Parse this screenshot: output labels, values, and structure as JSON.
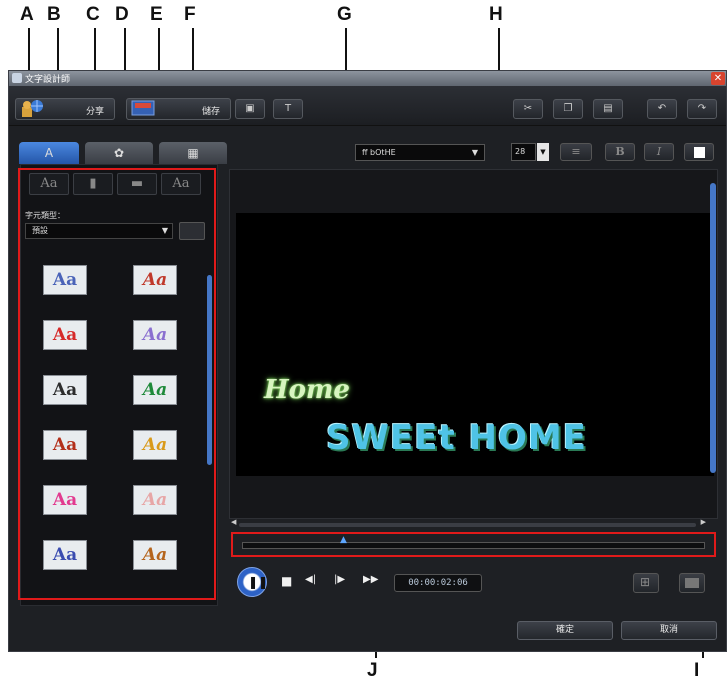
{
  "window": {
    "title": "文字設計師",
    "close_glyph": "✕"
  },
  "callouts": {
    "a": "A",
    "b": "B",
    "c": "C",
    "d": "D",
    "e": "E",
    "f": "F",
    "g": "G",
    "h": "H",
    "i": "I",
    "j": "J"
  },
  "toolbar": {
    "share_label": "分享",
    "save_label": "儲存",
    "icons": [
      "share-templates-icon",
      "save-template-icon",
      "import-image-icon",
      "insert-text-icon",
      "cut-icon",
      "copy-icon",
      "paste-icon",
      "undo-icon",
      "redo-icon"
    ]
  },
  "tabs": [
    {
      "label": "A",
      "icon": "text-properties-icon",
      "active": true
    },
    {
      "label": "✿",
      "icon": "particle-effects-icon",
      "active": false
    },
    {
      "label": "▦",
      "icon": "background-icon",
      "active": false
    }
  ],
  "left_panel": {
    "format_buttons": [
      "Aa",
      "▮",
      "▬",
      "Aa"
    ],
    "font_type_label": "字元類型：",
    "font_type_value": "預設",
    "presets": [
      {
        "text": "Aa",
        "color": "#4a63b8"
      },
      {
        "text": "Aa",
        "color": "#c0392b"
      },
      {
        "text": "Aa",
        "color": "#d62a2a"
      },
      {
        "text": "Aa",
        "color": "#8a6fd0"
      },
      {
        "text": "Aa",
        "color": "#2d2d2d"
      },
      {
        "text": "Aa",
        "color": "#1f8a3a"
      },
      {
        "text": "Aa",
        "color": "#b32f1a"
      },
      {
        "text": "Aa",
        "color": "#d99a1a"
      },
      {
        "text": "Aa",
        "color": "#e23a8f"
      },
      {
        "text": "Aa",
        "color": "#e7a6a6"
      },
      {
        "text": "Aa",
        "color": "#3a4cb0"
      },
      {
        "text": "Aa",
        "color": "#b5651d"
      }
    ]
  },
  "format_bar": {
    "font_name": "ff bOtHE",
    "font_size": "28",
    "align_glyph": "≡",
    "bold_glyph": "B",
    "italic_glyph": "I",
    "color_swatch": "#ffffff"
  },
  "preview": {
    "line1": "Home",
    "line2": "SWEEt HOME"
  },
  "timeline": {
    "marker_glyph": "▲",
    "position": 0.22
  },
  "playback": {
    "pause_glyph": "❚❚",
    "stop_glyph": "■",
    "prev_frame_glyph": "◀|",
    "next_frame_glyph": "|▶",
    "fast_forward_glyph": "▶▶",
    "timecode": "00:00:02:06"
  },
  "footer": {
    "ok_label": "確定",
    "cancel_label": "取消"
  }
}
